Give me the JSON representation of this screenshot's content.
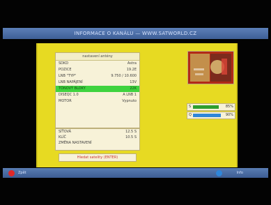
{
  "header": {
    "title": "INFORMACE O KANÁLU — WWW.SATWORLD.CZ"
  },
  "left_box": {
    "title": "nastavení antény",
    "rows": [
      {
        "label": "SDKD",
        "value": "Astra"
      },
      {
        "label": "POZICE",
        "value": "19.2E"
      },
      {
        "label": "LNB \"TYP\"",
        "value": "9.750 / 10.600"
      },
      {
        "label": "LNB NAPÁJENÍ",
        "value": "13V"
      },
      {
        "label": "TÓNOVÝ BLOKY",
        "value": "22K"
      },
      {
        "label": "DISEQC 1.0",
        "value": "A LNB 1"
      },
      {
        "label": "MOTOR",
        "value": "Vypnuto"
      }
    ],
    "selected_row_index": 4
  },
  "bottom_box": {
    "rows": [
      {
        "label": "SÍŤOVÁ",
        "value": "12.5 S"
      },
      {
        "label": "KLÍČ",
        "value": "10.5 S"
      },
      {
        "label": "ZMĚNA NASTAVENÍ",
        "value": ""
      }
    ]
  },
  "button": {
    "label": "Hledat satelity (ENTER)"
  },
  "signals": [
    {
      "label": "S",
      "percent": 85,
      "display": "85%",
      "color": "#2e9e2e"
    },
    {
      "label": "Q",
      "percent": 90,
      "display": "90%",
      "color": "#2f86d9"
    }
  ],
  "footer": {
    "left_label": "Zpět",
    "right_label": "Info"
  }
}
